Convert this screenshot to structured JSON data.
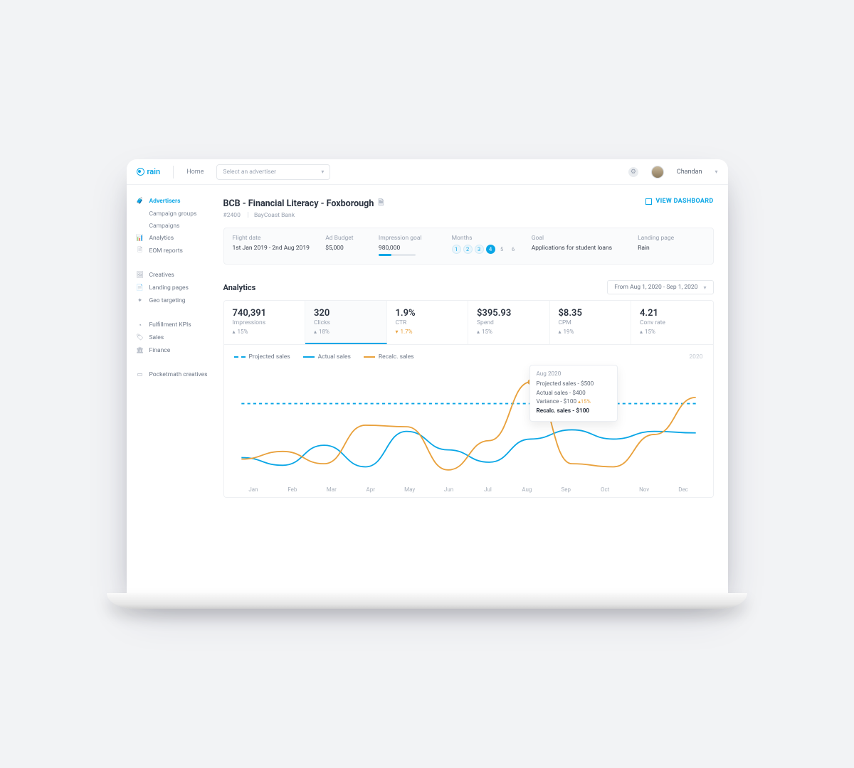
{
  "brand": {
    "name": "rain",
    "home": "Home"
  },
  "header": {
    "advertiser_placeholder": "Select an advertiser",
    "user": "Chandan"
  },
  "sidebar": {
    "groups": [
      {
        "items": [
          {
            "icon": "briefcase-icon",
            "label": "Advertisers",
            "active": true
          },
          {
            "sub": true,
            "label": "Campaign groups"
          },
          {
            "sub": true,
            "label": "Campaigns"
          },
          {
            "icon": "bars-icon",
            "label": "Analytics"
          },
          {
            "icon": "doc-icon",
            "label": "EOM reports"
          }
        ]
      },
      {
        "items": [
          {
            "icon": "image-icon",
            "label": "Creatives"
          },
          {
            "icon": "page-icon",
            "label": "Landing pages"
          },
          {
            "icon": "target-icon",
            "label": "Geo targeting"
          }
        ]
      },
      {
        "items": [
          {
            "icon": "gauge-icon",
            "label": "Fulfillment KPIs"
          },
          {
            "icon": "tag-icon",
            "label": "Sales"
          },
          {
            "icon": "bank-icon",
            "label": "Finance"
          }
        ]
      },
      {
        "items": [
          {
            "icon": "card-icon",
            "label": "Pocketmath creatives"
          }
        ]
      }
    ]
  },
  "page": {
    "title": "BCB - Financial Literacy - Foxborough",
    "id": "#2400",
    "advertiser": "BayCoast Bank",
    "view_dashboard": "VIEW DASHBOARD"
  },
  "strip": {
    "flight": {
      "label": "Flight date",
      "value": "1st Jan 2019 - 2nd Aug 2019"
    },
    "budget": {
      "label": "Ad Budget",
      "value": "$5,000"
    },
    "goal": {
      "label": "Impression goal",
      "value": "980,000"
    },
    "months": {
      "label": "Months",
      "values": [
        "1",
        "2",
        "3",
        "4",
        "5",
        "6"
      ],
      "current_index": 3
    },
    "objective": {
      "label": "Goal",
      "value": "Applications for student loans"
    },
    "landing": {
      "label": "Landing page",
      "value": "Rain"
    }
  },
  "analytics": {
    "section": "Analytics",
    "date_range": "From Aug 1, 2020 - Sep 1, 2020",
    "kpis": [
      {
        "value": "740,391",
        "label": "Impressions",
        "delta": "15%",
        "dir": "up"
      },
      {
        "value": "320",
        "label": "Clicks",
        "delta": "18%",
        "dir": "up",
        "active": true
      },
      {
        "value": "1.9%",
        "label": "CTR",
        "delta": "1.7%",
        "dir": "down"
      },
      {
        "value": "$395.93",
        "label": "Spend",
        "delta": "15%",
        "dir": "up"
      },
      {
        "value": "$8.35",
        "label": "CPM",
        "delta": "19%",
        "dir": "up"
      },
      {
        "value": "4.21",
        "label": "Conv rate",
        "delta": "15%",
        "dir": "up"
      }
    ]
  },
  "chart_data": {
    "type": "line",
    "year": "2020",
    "categories": [
      "Jan",
      "Feb",
      "Mar",
      "Apr",
      "May",
      "Jun",
      "Jul",
      "Aug",
      "Sep",
      "Oct",
      "Nov",
      "Dec"
    ],
    "ylim": [
      0,
      700
    ],
    "series": [
      {
        "name": "Projected sales",
        "style": "dashed",
        "color": "#0aa6e6",
        "values": [
          500,
          500,
          500,
          500,
          500,
          500,
          500,
          500,
          500,
          500,
          500,
          500
        ]
      },
      {
        "name": "Actual sales",
        "style": "solid",
        "color": "#0aa6e6",
        "values": [
          150,
          100,
          230,
          90,
          320,
          200,
          120,
          270,
          330,
          270,
          320,
          310
        ]
      },
      {
        "name": "Recalc. sales",
        "style": "solid",
        "color": "#e9a13c",
        "values": [
          140,
          190,
          110,
          360,
          350,
          70,
          260,
          640,
          110,
          90,
          300,
          540
        ]
      }
    ],
    "tooltip": {
      "month": "Aug 2020",
      "rows": [
        {
          "label": "Projected sales",
          "value": "$500"
        },
        {
          "label": "Actual sales",
          "value": "$400"
        },
        {
          "label": "Variance",
          "value": "$100",
          "pct": "15%"
        },
        {
          "label": "Recalc. sales",
          "value": "$100",
          "bold": true
        }
      ]
    }
  }
}
